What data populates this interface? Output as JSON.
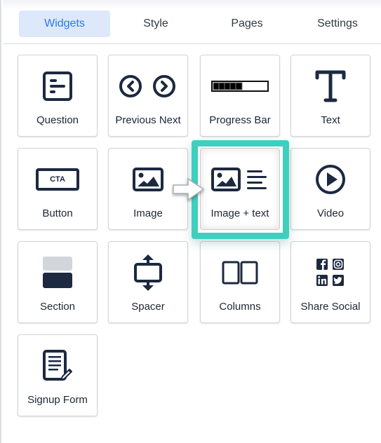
{
  "tabs": [
    {
      "label": "Widgets",
      "active": true
    },
    {
      "label": "Style",
      "active": false
    },
    {
      "label": "Pages",
      "active": false
    },
    {
      "label": "Settings",
      "active": false
    }
  ],
  "widgets": [
    {
      "label": "Question",
      "icon": "question-form-icon"
    },
    {
      "label": "Previous Next",
      "icon": "previous-next-icon"
    },
    {
      "label": "Progress Bar",
      "icon": "progress-bar-icon",
      "progress_fraction": 0.55
    },
    {
      "label": "Text",
      "icon": "text-t-icon"
    },
    {
      "label": "Button",
      "icon": "cta-button-icon",
      "icon_text": "CTA"
    },
    {
      "label": "Image",
      "icon": "image-icon"
    },
    {
      "label": "Image + text",
      "icon": "image-text-icon",
      "highlighted": true
    },
    {
      "label": "Video",
      "icon": "play-icon"
    },
    {
      "label": "Section",
      "icon": "section-icon"
    },
    {
      "label": "Spacer",
      "icon": "spacer-icon"
    },
    {
      "label": "Columns",
      "icon": "columns-icon"
    },
    {
      "label": "Share Social",
      "icon": "social-icons"
    },
    {
      "label": "Signup Form",
      "icon": "signup-form-icon"
    }
  ],
  "colors": {
    "accent": "#2a78f0",
    "active_tab_bg": "#dde9fb",
    "highlight": "#3ecfbf",
    "icon": "#1c2940"
  }
}
